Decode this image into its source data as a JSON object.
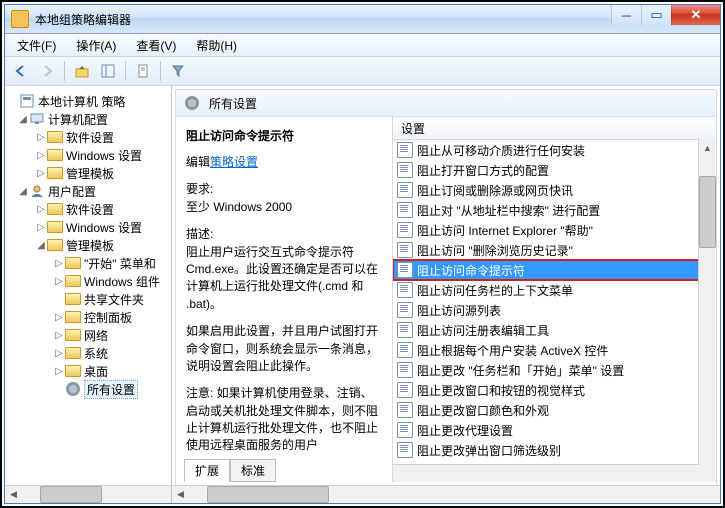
{
  "window": {
    "title": "本地组策略编辑器"
  },
  "menu": {
    "file": "文件(F)",
    "action": "操作(A)",
    "view": "查看(V)",
    "help": "帮助(H)"
  },
  "tree": {
    "root": "本地计算机 策略",
    "computer": "计算机配置",
    "c_soft": "软件设置",
    "c_win": "Windows 设置",
    "c_tmpl": "管理模板",
    "user": "用户配置",
    "u_soft": "软件设置",
    "u_win": "Windows 设置",
    "u_tmpl": "管理模板",
    "start": "\"开始\" 菜单和",
    "wincomp": "Windows 组件",
    "share": "共享文件夹",
    "cpanel": "控制面板",
    "net": "网络",
    "sys": "系统",
    "desk": "桌面",
    "all": "所有设置"
  },
  "header": {
    "title": "所有设置"
  },
  "desc": {
    "title": "阻止访问命令提示符",
    "editlabel": "编辑",
    "editlink": "策略设置",
    "reqlabel": "要求:",
    "req": "至少 Windows 2000",
    "dlabel": "描述:",
    "d1": "阻止用户运行交互式命令提示符 Cmd.exe。此设置还确定是否可以在计算机上运行批处理文件(.cmd 和 .bat)。",
    "d2": "如果启用此设置，并且用户试图打开命令窗口，则系统会显示一条消息，说明设置会阻止此操作。",
    "d3": "注意: 如果计算机使用登录、注销、启动或关机批处理文件脚本，则不阻止计算机运行批处理文件，也不阻止使用远程桌面服务的用户"
  },
  "tabs": {
    "ext": "扩展",
    "std": "标准"
  },
  "list": {
    "col": "设置",
    "items": [
      "阻止从可移动介质进行任何安装",
      "阻止打开窗口方式的配置",
      "阻止订阅或删除源或网页快讯",
      "阻止对 \"从地址栏中搜索\" 进行配置",
      "阻止访问 Internet Explorer \"帮助\"",
      "阻止访问 \"删除浏览历史记录\"",
      "阻止访问命令提示符",
      "阻止访问任务栏的上下文菜单",
      "阻止访问源列表",
      "阻止访问注册表编辑工具",
      "阻止根据每个用户安装 ActiveX 控件",
      "阻止更改 \"任务栏和「开始」菜单\" 设置",
      "阻止更改窗口和按钮的视觉样式",
      "阻止更改窗口颜色和外观",
      "阻止更改代理设置",
      "阻止更改弹出窗口筛选级别"
    ],
    "selected": 6
  }
}
